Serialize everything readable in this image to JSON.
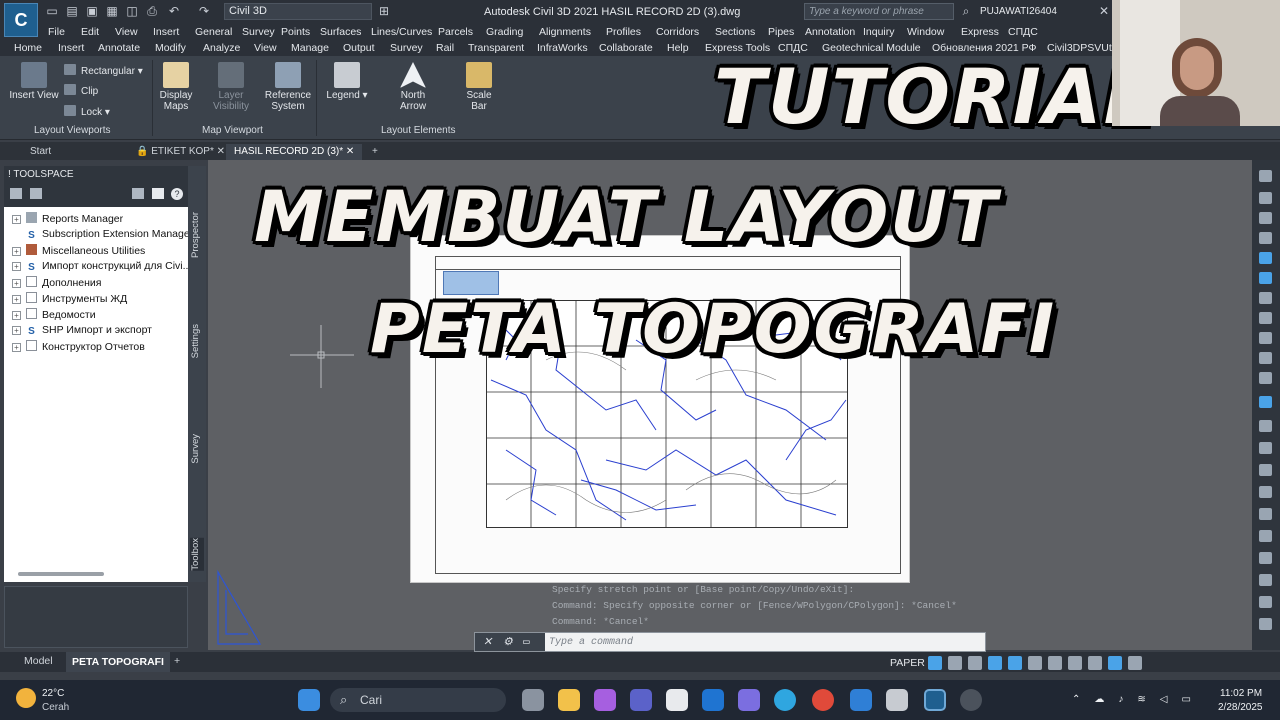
{
  "app": {
    "logo_text": "C",
    "workspace": "Civil 3D",
    "window_title": "Autodesk Civil 3D 2021    HASIL RECORD 2D (3).dwg",
    "search_placeholder": "Type a keyword or phrase",
    "user": "PUJAWATI26404"
  },
  "menu": [
    "File",
    "Edit",
    "View",
    "Insert",
    "General",
    "Survey",
    "Points",
    "Surfaces",
    "Lines/Curves",
    "Parcels",
    "Grading",
    "Alignments",
    "Profiles",
    "Corridors",
    "Sections",
    "Pipes",
    "Annotation",
    "Inquiry",
    "Window",
    "Express",
    "СПДС"
  ],
  "ribbon_tabs": [
    "Home",
    "Insert",
    "Annotate",
    "Modify",
    "Analyze",
    "View",
    "Manage",
    "Output",
    "Survey",
    "Rail",
    "Transparent",
    "InfraWorks",
    "Collaborate",
    "Help",
    "Express Tools",
    "СПДС",
    "Geotechnical Module",
    "Обновления 2021 РФ",
    "Civil3DPSVUtils"
  ],
  "ribbon": {
    "insert_view": "Insert View",
    "rectangular": "Rectangular",
    "clip": "Clip",
    "lock": "Lock",
    "display_maps": "Display Maps",
    "layer_visibility": "Layer Visibility",
    "reference_system": "Reference System",
    "legend": "Legend",
    "north_arrow": "North Arrow",
    "scale_bar": "Scale Bar",
    "panel_layout_viewports": "Layout Viewports",
    "panel_map_viewport": "Map Viewport",
    "panel_layout_elements": "Layout Elements"
  },
  "doc_tabs": {
    "start": "Start",
    "etiket": "ETIKET KOP*",
    "hasil": "HASIL RECORD 2D (3)*"
  },
  "toolspace": {
    "title": "TOOLSPACE",
    "items": [
      "Reports Manager",
      "Subscription Extension Manager",
      "Miscellaneous Utilities",
      "Импорт конструкций для Civi...",
      "Дополнения",
      "Инструменты ЖД",
      "Ведомости",
      "SHP Импорт и экспорт",
      "Конструктор Отчетов"
    ],
    "vtabs": [
      "Prospector",
      "Settings",
      "Survey",
      "Toolbox"
    ]
  },
  "command_history": [
    "Specify stretch point or [Base point/Copy/Undo/eXit]:",
    "Command: Specify opposite corner or [Fence/WPolygon/CPolygon]: *Cancel*",
    "Command: *Cancel*"
  ],
  "command_placeholder": "Type a command",
  "overlay": {
    "line1": "TUTORIAL",
    "line2": "MEMBUAT LAYOUT",
    "line3": "PETA TOPOGRAFI"
  },
  "layout_tabs": {
    "model": "Model",
    "active": "PETA TOPOGRAFI"
  },
  "status": {
    "paper": "PAPER"
  },
  "taskbar": {
    "search": "Cari",
    "weather_temp": "22°C",
    "weather_cond": "Cerah",
    "time": "11:02 PM",
    "date": "2/28/2025"
  },
  "colors": {
    "overlay_text": "#f6f2ec",
    "map_lines": "#2a3fcf",
    "canvas": "#5e6064"
  }
}
